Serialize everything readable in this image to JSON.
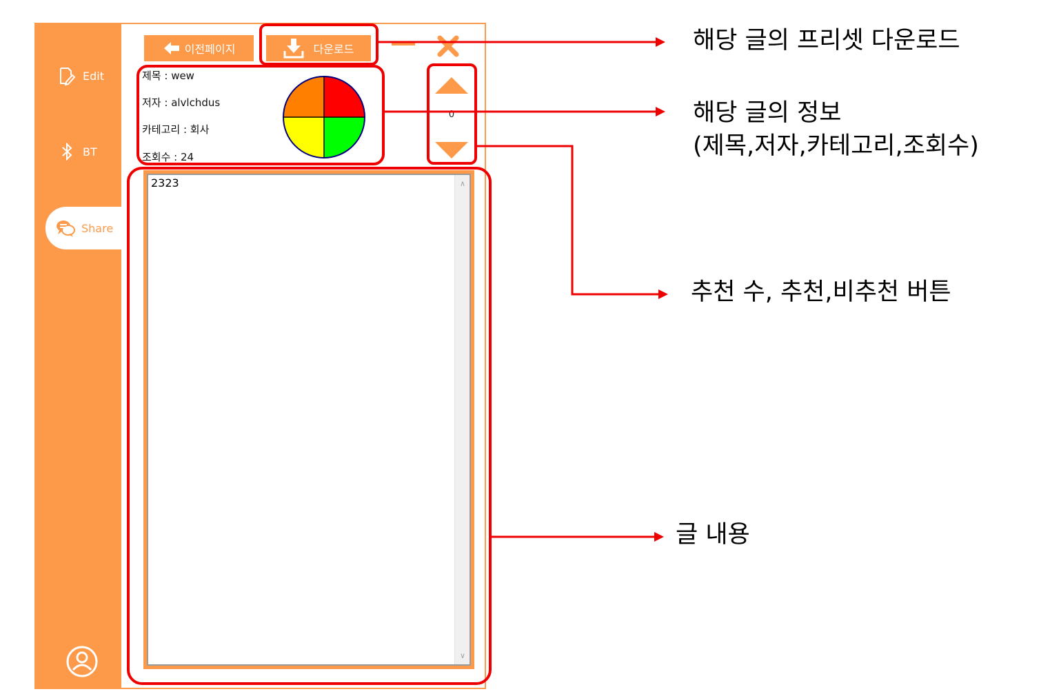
{
  "sidebar": {
    "items": [
      {
        "label": "Edit",
        "icon": "edit-icon",
        "active": false
      },
      {
        "label": "BT",
        "icon": "bluetooth-icon",
        "active": false
      },
      {
        "label": "Share",
        "icon": "chat-bubbles-icon",
        "active": true
      }
    ],
    "profile_icon": "user-circle-icon"
  },
  "toolbar": {
    "prev_label": "이전페이지",
    "download_label": "다운로드"
  },
  "post": {
    "title_label": "제목 : wew",
    "author_label": "저자 : alvlchdus",
    "category_label": "카테고리 : 회사",
    "views_label": "조회수 : 24",
    "votes": "0",
    "content": "2323"
  },
  "category_pie_colors": [
    "#FF7F00",
    "#FF0000",
    "#FFFF00",
    "#00FF00"
  ],
  "colors": {
    "accent": "#FD9A4A",
    "highlight": "#EE0000"
  },
  "annotations": {
    "download": "해당 글의 프리셋 다운로드",
    "info_line1": "해당 글의 정보",
    "info_line2": "(제목,저자,카테고리,조회수)",
    "vote": "추천 수, 추천,비추천 버튼",
    "content": "글 내용"
  }
}
